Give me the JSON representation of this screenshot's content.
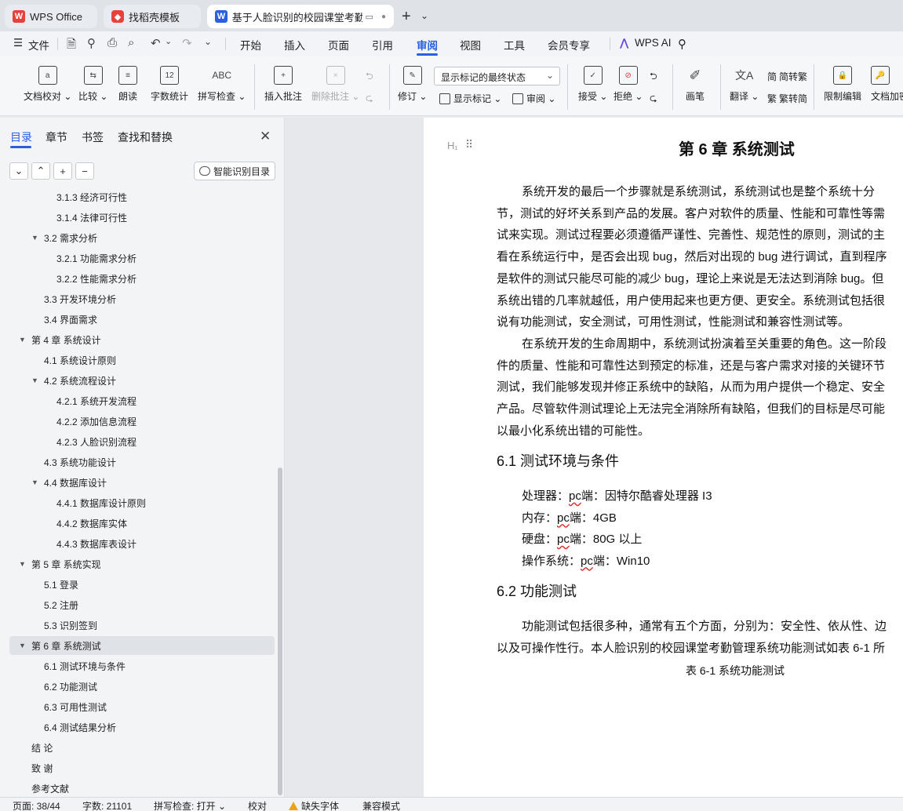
{
  "tabs": [
    {
      "label": "WPS Office",
      "icon": "wps-logo-icon",
      "color": "#e8403a"
    },
    {
      "label": "找稻壳模板",
      "icon": "docer-icon",
      "color": "#e8403a"
    },
    {
      "label": "基于人脸识别的校园课堂考勤管",
      "icon": "word-doc-icon",
      "color": "#2b5fe0"
    }
  ],
  "menu": {
    "file": "文件",
    "items": [
      "开始",
      "插入",
      "页面",
      "引用",
      "审阅",
      "视图",
      "工具",
      "会员专享"
    ],
    "active": "审阅",
    "wps_ai": "WPS AI"
  },
  "ribbon": {
    "doc_check": "文档校对",
    "compare": "比较",
    "read_aloud": "朗读",
    "word_count": "字数统计",
    "spell_check": "拼写检查",
    "insert_comment": "插入批注",
    "delete_comment": "删除批注",
    "revise": "修订",
    "markup_select": "显示标记的最终状态",
    "show_markup": "显示标记",
    "review": "审阅",
    "accept": "接受",
    "reject": "拒绝",
    "pen": "画笔",
    "translate": "翻译",
    "to_traditional": "简转繁",
    "to_simplified": "繁转简",
    "restrict_edit": "限制编辑",
    "doc_encrypt": "文档加密",
    "word_count_icon_text": "12",
    "spell_icon_text": "ABC"
  },
  "nav": {
    "tabs": [
      "目录",
      "章节",
      "书签",
      "查找和替换"
    ],
    "active_tab": "目录",
    "smart_toc": "智能识别目录",
    "toc": [
      {
        "text": "3.1.3  经济可行性",
        "level": 3
      },
      {
        "text": "3.1.4  法律可行性",
        "level": 3
      },
      {
        "text": "3.2 需求分析",
        "level": 2,
        "expanded": true
      },
      {
        "text": "3.2.1  功能需求分析",
        "level": 3
      },
      {
        "text": "3.2.2  性能需求分析",
        "level": 3
      },
      {
        "text": "3.3 开发环境分析",
        "level": 2
      },
      {
        "text": "3.4 界面需求",
        "level": 2
      },
      {
        "text": "第 4 章  系统设计",
        "level": 1,
        "expanded": true
      },
      {
        "text": "4.1 系统设计原则",
        "level": 2
      },
      {
        "text": "4.2 系统流程设计",
        "level": 2,
        "expanded": true
      },
      {
        "text": "4.2.1 系统开发流程",
        "level": 3
      },
      {
        "text": "4.2.2  添加信息流程",
        "level": 3
      },
      {
        "text": "4.2.3  人脸识别流程",
        "level": 3
      },
      {
        "text": "4.3  系统功能设计",
        "level": 2
      },
      {
        "text": "4.4  数据库设计",
        "level": 2,
        "expanded": true
      },
      {
        "text": "4.4.1  数据库设计原则",
        "level": 3
      },
      {
        "text": "4.4.2  数据库实体",
        "level": 3
      },
      {
        "text": "4.4.3  数据库表设计",
        "level": 3
      },
      {
        "text": "第 5 章  系统实现",
        "level": 1,
        "expanded": true
      },
      {
        "text": "5.1  登录",
        "level": 2
      },
      {
        "text": "5.2  注册",
        "level": 2
      },
      {
        "text": "5.3  识别签到",
        "level": 2
      },
      {
        "text": "第 6 章  系统测试",
        "level": 1,
        "expanded": true,
        "selected": true
      },
      {
        "text": "6.1 测试环境与条件",
        "level": 2
      },
      {
        "text": "6.2 功能测试",
        "level": 2
      },
      {
        "text": "6.3 可用性测试",
        "level": 2
      },
      {
        "text": "6.4 测试结果分析",
        "level": 2
      },
      {
        "text": "结      论",
        "level": 1
      },
      {
        "text": "致      谢",
        "level": 1
      },
      {
        "text": "参考文献",
        "level": 1
      }
    ]
  },
  "document": {
    "chapter_title": "第 6 章  系统测试",
    "para1": [
      "系统开发的最后一个步骤就是系统测试，系统测试也是整个系统十分",
      "节，测试的好坏关系到产品的发展。客户对软件的质量、性能和可靠性等需",
      "试来实现。测试过程要必须遵循严谨性、完善性、规范性的原则，测试的主",
      "看在系统运行中，是否会出现 bug，然后对出现的 bug 进行调试，直到程序",
      "是软件的测试只能尽可能的减少 bug，理论上来说是无法达到消除 bug。但",
      "系统出错的几率就越低，用户使用起来也更方便、更安全。系统测试包括很",
      "说有功能测试，安全测试，可用性测试，性能测试和兼容性测试等。"
    ],
    "para2": [
      "在系统开发的生命周期中，系统测试扮演着至关重要的角色。这一阶段",
      "件的质量、性能和可靠性达到预定的标准，还是与客户需求对接的关键环节",
      "测试，我们能够发现并修正系统中的缺陷，从而为用户提供一个稳定、安全",
      "产品。尽管软件测试理论上无法完全消除所有缺陷，但我们的目标是尽可能",
      "以最小化系统出错的可能性。"
    ],
    "section1_title": "6.1 测试环境与条件",
    "specs": [
      {
        "label": "处理器：",
        "term": "pc",
        "value": "端：因特尔酷睿处理器 I3"
      },
      {
        "label": "内存：",
        "term": "pc",
        "value": "端：4GB"
      },
      {
        "label": "硬盘：",
        "term": "pc",
        "value": "端：80G 以上"
      },
      {
        "label": "操作系统：",
        "term": "pc",
        "value": "端：Win10"
      }
    ],
    "section2_title": "6.2 功能测试",
    "para3": [
      "功能测试包括很多种，通常有五个方面，分别为：安全性、依从性、边",
      "以及可操作性行。本人脸识别的校园课堂考勤管理系统功能测试如表 6-1 所"
    ],
    "table_caption": "表 6-1  系统功能测试"
  },
  "status": {
    "page": "页面: 38/44",
    "words": "字数: 21101",
    "spell": "拼写检查: 打开",
    "proof": "校对",
    "missing_font": "缺失字体",
    "compat": "兼容模式"
  }
}
